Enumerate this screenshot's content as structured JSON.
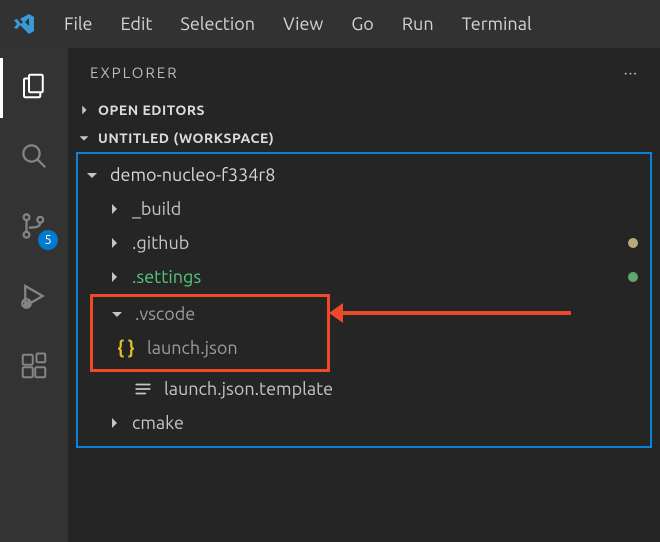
{
  "menu": {
    "items": [
      "File",
      "Edit",
      "Selection",
      "View",
      "Go",
      "Run",
      "Terminal"
    ]
  },
  "activitybar": {
    "scm_badge": "5"
  },
  "sidebar": {
    "title": "EXPLORER",
    "open_editors": "OPEN EDITORS",
    "workspace": "UNTITLED (WORKSPACE)"
  },
  "tree": {
    "root": "demo-nucleo-f334r8",
    "items": {
      "build": "_build",
      "github": ".github",
      "settings": ".settings",
      "vscode": ".vscode",
      "launch_json": "launch.json",
      "launch_template": "launch.json.template",
      "cmake": "cmake"
    }
  },
  "colors": {
    "root_dot": "#b8a97d",
    "github_dot": "#b8a97d",
    "settings_dot": "#5fa86f",
    "settings_text": "#55c778"
  }
}
